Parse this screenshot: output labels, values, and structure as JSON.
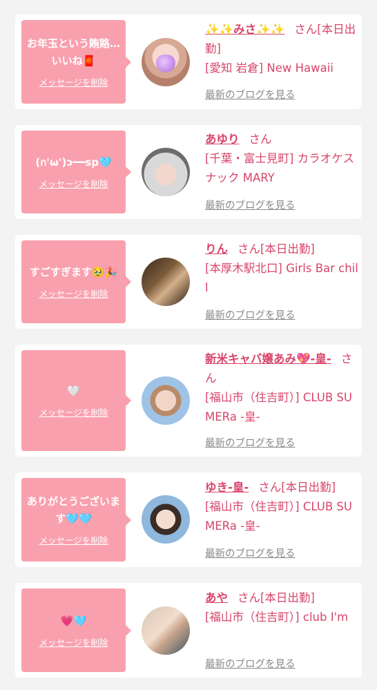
{
  "colors": {
    "accent": "#d8456a",
    "bubble": "#f9a0ae",
    "link_gray": "#8a8a8a"
  },
  "cards": [
    {
      "message": "お年玉という賄賂…いいね🧧",
      "delete_label": "メッセージを削除",
      "name": "✨✨みさ✨✨",
      "honorific": "さん[本日出勤]",
      "shop": "[愛知 岩倉] New Hawaii",
      "blog_label": "最新のブログを見る"
    },
    {
      "message": "(ก'ω')ɔ━━sp🩵",
      "delete_label": "メッセージを削除",
      "name": "あゆり",
      "honorific": "さん",
      "shop": "[千葉・富士見町] カラオケスナック MARY",
      "blog_label": "最新のブログを見る"
    },
    {
      "message": "すごすぎます🥹🎉",
      "delete_label": "メッセージを削除",
      "name": "りん",
      "honorific": "さん[本日出勤]",
      "shop": "[本厚木駅北口] Girls Bar chill",
      "blog_label": "最新のブログを見る"
    },
    {
      "message": "🤍",
      "delete_label": "メッセージを削除",
      "name": "新米キャバ嬢あみ💖-皇-",
      "honorific": "さん",
      "shop": "[福山市（住吉町）] CLUB SUMERa -皇-",
      "blog_label": "最新のブログを見る"
    },
    {
      "message": "ありがとうございます🩵🩵",
      "delete_label": "メッセージを削除",
      "name": "ゆき-皇-",
      "honorific": "さん[本日出勤]",
      "shop": "[福山市（住吉町）] CLUB SUMERa -皇-",
      "blog_label": "最新のブログを見る"
    },
    {
      "message": "💗🩵",
      "delete_label": "メッセージを削除",
      "name": "あや",
      "honorific": "さん[本日出勤]",
      "shop": "[福山市（住吉町）] club I'm",
      "blog_label": "最新のブログを見る"
    }
  ]
}
